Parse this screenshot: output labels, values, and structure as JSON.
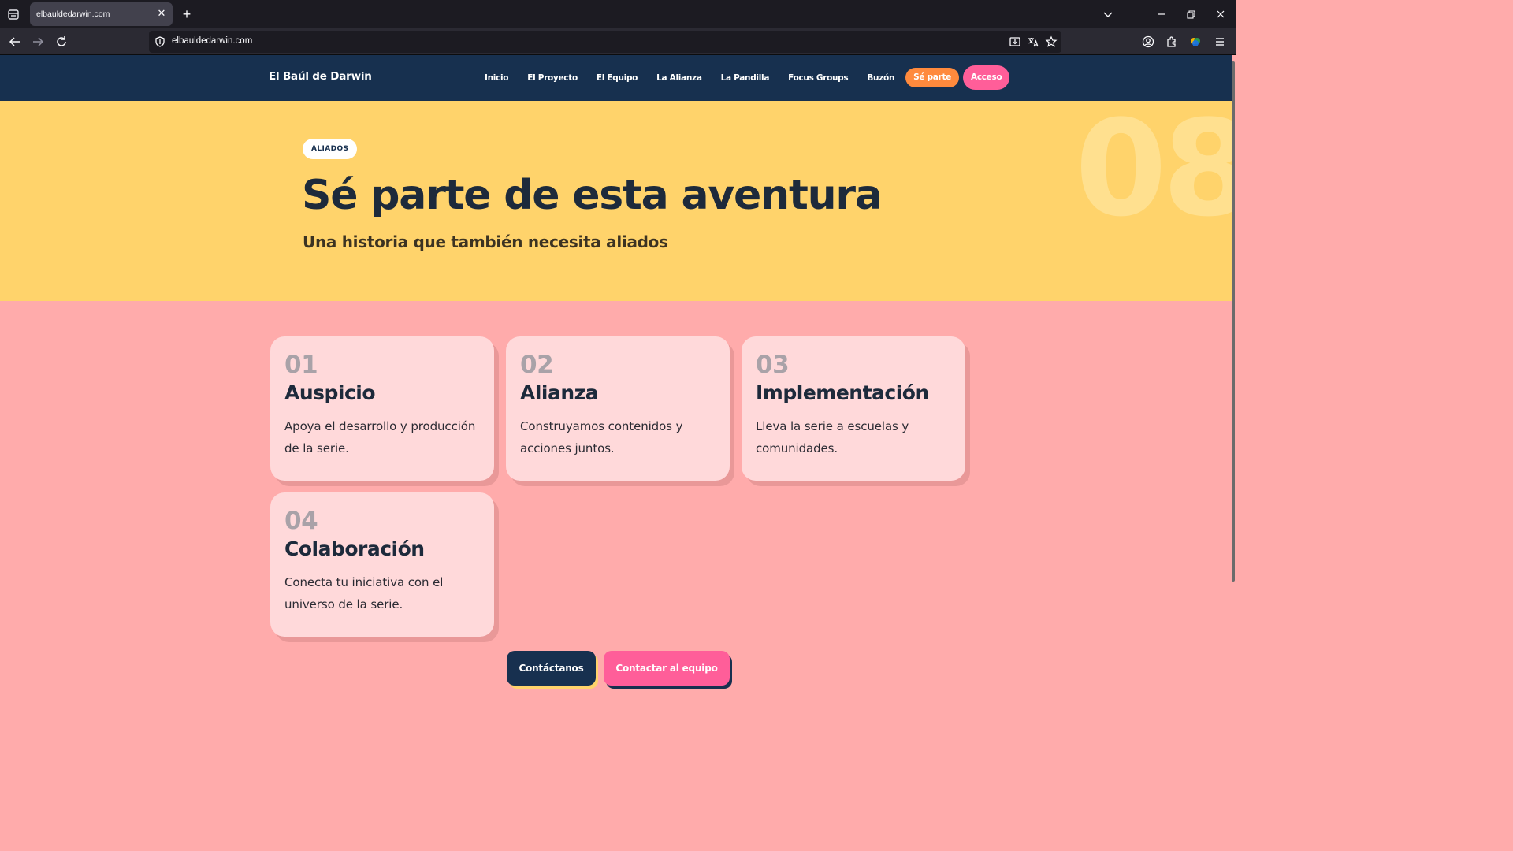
{
  "browser": {
    "tab_title": "elbauldedarwin.com",
    "url": "elbauldedarwin.com"
  },
  "site": {
    "brand": "El Baúl de Darwin",
    "nav": [
      "Inicio",
      "El Proyecto",
      "El Equipo",
      "La Alianza",
      "La Pandilla",
      "Focus Groups",
      "Buzón"
    ],
    "cta_join": "Sé parte",
    "cta_login": "Acceso"
  },
  "hero": {
    "badge": "ALIADOS",
    "section_number": "08",
    "title": "Sé parte de esta aventura",
    "subtitle": "Una historia que también necesita aliados"
  },
  "cards": [
    {
      "number": "01",
      "title": "Auspicio",
      "description": "Apoya el desarrollo y producción de la serie."
    },
    {
      "number": "02",
      "title": "Alianza",
      "description": "Construyamos contenidos y acciones juntos."
    },
    {
      "number": "03",
      "title": "Implementación",
      "description": "Lleva la serie a escuelas y comunidades."
    },
    {
      "number": "04",
      "title": "Colaboración",
      "description": "Conecta tu iniciativa con el universo de la serie."
    }
  ],
  "buttons": {
    "contact": "Contáctanos",
    "contact_team": "Contactar al equipo"
  },
  "colors": {
    "header_bg": "#17304f",
    "hero_bg": "#ffd36b",
    "page_bg": "#ffabab",
    "card_bg": "#ffd9da",
    "accent_orange": "#ff8a3d",
    "accent_pink": "#ff5e99"
  },
  "icons": [
    "tab-list-icon",
    "close-icon",
    "new-tab-icon",
    "chevron-down-icon",
    "minimize-icon",
    "restore-icon",
    "window-close-icon",
    "back-icon",
    "forward-icon",
    "reload-icon",
    "shield-icon",
    "install-icon",
    "translate-icon",
    "bookmark-star-icon",
    "account-icon",
    "extensions-icon",
    "addon-icon",
    "menu-icon"
  ]
}
